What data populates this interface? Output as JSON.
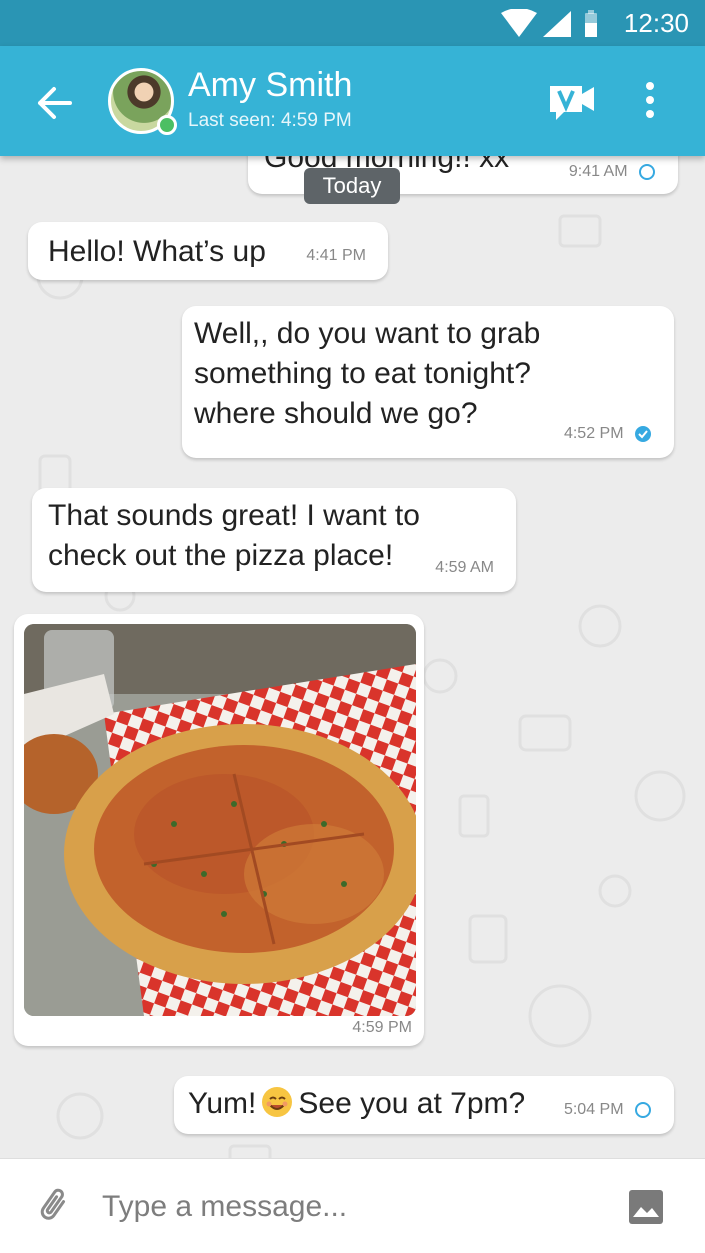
{
  "status_bar": {
    "time": "12:30"
  },
  "header": {
    "contact_name": "Amy Smith",
    "last_seen": "Last seen: 4:59 PM",
    "icons": [
      "back-arrow-icon",
      "video-call-icon",
      "more-vert-icon"
    ]
  },
  "chat": {
    "date_badge": "Today",
    "messages": [
      {
        "direction": "out",
        "text": "Good morning!! xx",
        "time": "9:41 AM",
        "status": "sent"
      },
      {
        "direction": "in",
        "text": "Hello! What’s up",
        "time": "4:41 PM"
      },
      {
        "direction": "out",
        "text": "Well,, do you want to grab something to eat tonight? where should we go?",
        "time": "4:52 PM",
        "status": "read"
      },
      {
        "direction": "in",
        "text": "That sounds great! I want to check out the pizza place!",
        "time": "4:59 AM"
      },
      {
        "direction": "in",
        "type": "image",
        "image": "pizza-photo",
        "time": "4:59 PM"
      },
      {
        "direction": "out",
        "text_before": "Yum!",
        "emoji": "smiling-face-emoji",
        "text_after": "See you at 7pm?",
        "time": "5:04 PM",
        "status": "sent"
      }
    ]
  },
  "composer": {
    "placeholder": "Type a message..."
  },
  "colors": {
    "status_bar": "#2a95b4",
    "app_bar": "#36b3d6",
    "read_tick": "#36a9e1",
    "online": "#4cbf63",
    "chat_bg": "#ececec"
  }
}
